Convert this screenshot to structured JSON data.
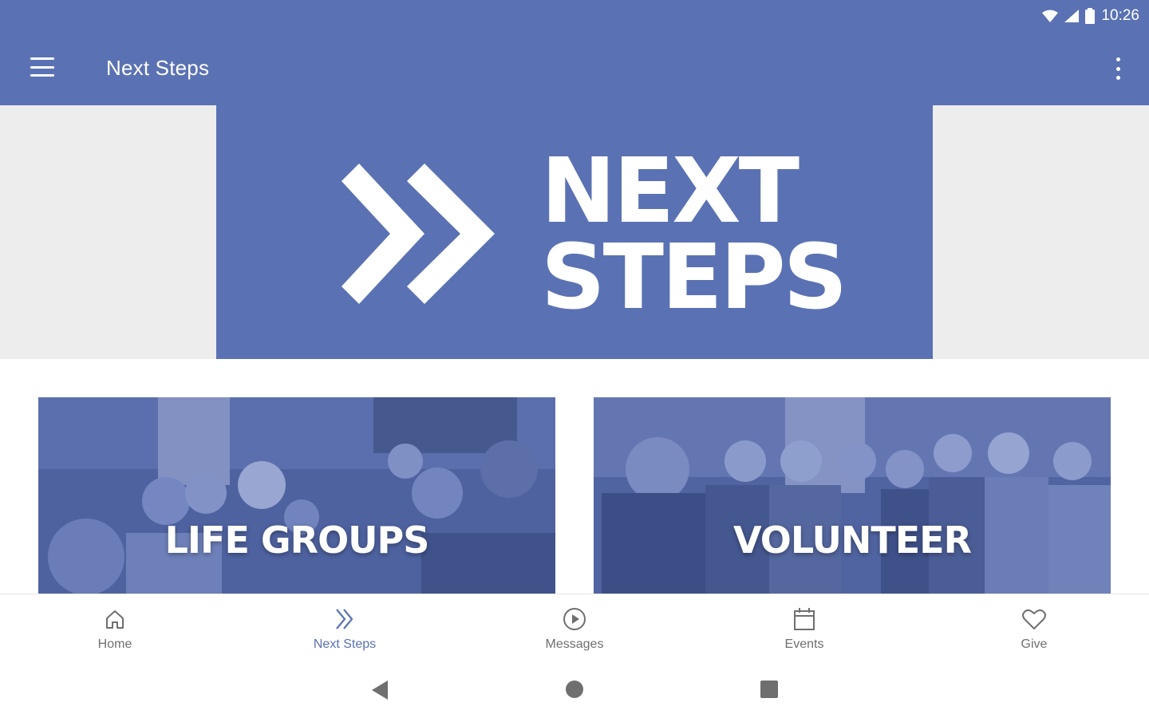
{
  "status_bar": {
    "time": "10:26"
  },
  "app_bar": {
    "title": "Next Steps"
  },
  "hero": {
    "line1": "NEXT",
    "line2": "STEPS"
  },
  "cards": [
    {
      "label": "LIFE GROUPS"
    },
    {
      "label": "VOLUNTEER"
    }
  ],
  "bottom_nav": [
    {
      "label": "Home",
      "icon": "home-icon",
      "active": false
    },
    {
      "label": "Next Steps",
      "icon": "double-chevron-icon",
      "active": true
    },
    {
      "label": "Messages",
      "icon": "play-circle-icon",
      "active": false
    },
    {
      "label": "Events",
      "icon": "calendar-icon",
      "active": false
    },
    {
      "label": "Give",
      "icon": "heart-icon",
      "active": false
    }
  ],
  "colors": {
    "brand": "#5a72b3",
    "accent_text": "#5a72b3",
    "inactive_text": "#6f6f6f"
  }
}
